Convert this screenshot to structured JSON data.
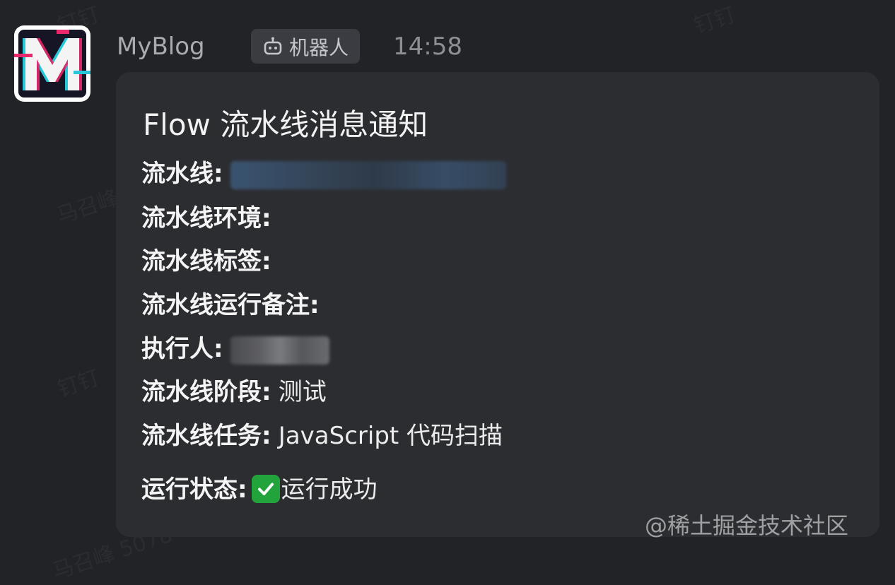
{
  "message": {
    "sender": "MyBlog",
    "bot_badge": "机器人",
    "time": "14:58",
    "avatar_letter": "M"
  },
  "card": {
    "title": "Flow 流水线消息通知",
    "rows": [
      {
        "label": "流水线:",
        "value": ""
      },
      {
        "label": "流水线环境:",
        "value": ""
      },
      {
        "label": "流水线标签:",
        "value": ""
      },
      {
        "label": "流水线运行备注:",
        "value": ""
      },
      {
        "label": "执行人:",
        "value": ""
      },
      {
        "label": "流水线阶段:",
        "value": "测试"
      },
      {
        "label": "流水线任务:",
        "value": "JavaScript 代码扫描"
      },
      {
        "label": "运行状态:",
        "value": "运行成功"
      }
    ]
  },
  "watermarks": [
    "钉钉",
    "钉钉",
    "马召峰",
    "钉钉",
    "马召峰 5078"
  ],
  "footer_watermark": "@稀土掘金技术社区",
  "colors": {
    "background": "#222326",
    "card": "#2c2d31",
    "status_success": "#23a33b",
    "avatar_pink": "#e8286a",
    "avatar_cyan": "#28c7d8"
  },
  "icons": {
    "bot": "robot-icon",
    "status": "check-mark-icon"
  }
}
